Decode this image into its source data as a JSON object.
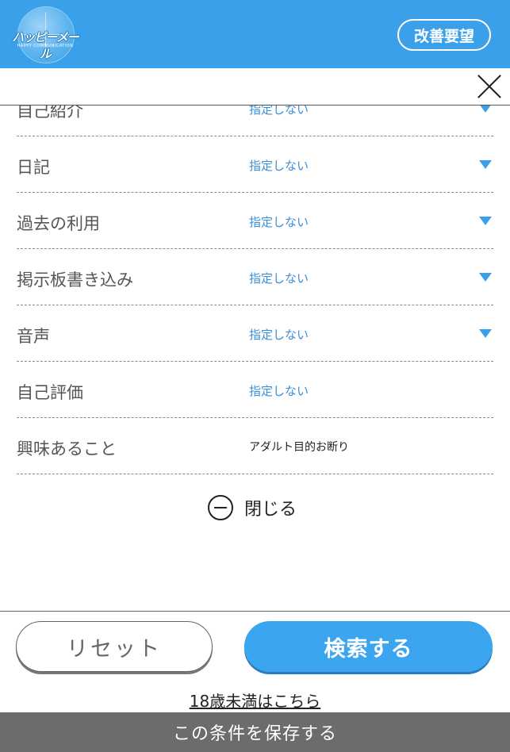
{
  "header": {
    "logo_text": "ハッピーメール",
    "logo_sub": "HAPPY COMMUNICATION",
    "improve_label": "改善要望",
    "accent": "#3aa0ea"
  },
  "close_icon": "close-icon",
  "rows": [
    {
      "label": "自己紹介",
      "value": "指定しない",
      "dropdown": true
    },
    {
      "label": "日記",
      "value": "指定しない",
      "dropdown": true
    },
    {
      "label": "過去の利用",
      "value": "指定しない",
      "dropdown": true
    },
    {
      "label": "掲示板書き込み",
      "value": "指定しない",
      "dropdown": true
    },
    {
      "label": "音声",
      "value": "指定しない",
      "dropdown": true
    },
    {
      "label": "自己評価",
      "value": "指定しない",
      "dropdown": false
    },
    {
      "label": "興味あること",
      "value": "アダルト目的お断り",
      "dropdown": false
    }
  ],
  "collapse": {
    "label": "閉じる"
  },
  "actions": {
    "reset_label": "リセット",
    "search_label": "検索する",
    "under18_label": "18歳未満はこちら",
    "save_label": "この条件を保存する"
  }
}
